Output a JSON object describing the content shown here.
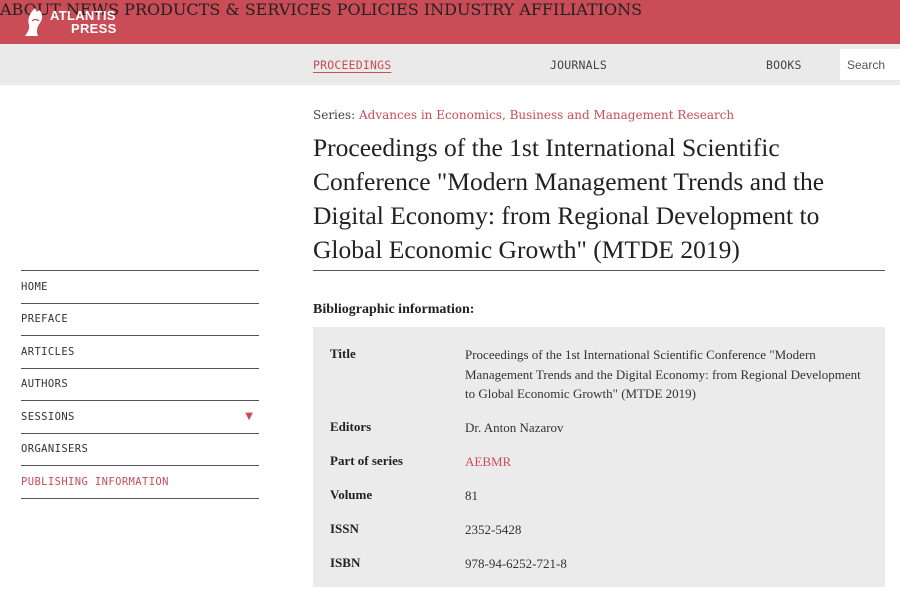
{
  "brand": {
    "line1": "ATLANTIS",
    "line2": "PRESS"
  },
  "topnav": [
    "ABOUT",
    "NEWS",
    "PRODUCTS & SERVICES",
    "POLICIES",
    "INDUSTRY AFFILIATIONS"
  ],
  "subnav": {
    "proceedings": "PROCEEDINGS",
    "journals": "JOURNALS",
    "books": "BOOKS",
    "search_placeholder": "Search"
  },
  "sidebar": [
    {
      "label": "HOME",
      "active": false
    },
    {
      "label": "PREFACE",
      "active": false
    },
    {
      "label": "ARTICLES",
      "active": false
    },
    {
      "label": "AUTHORS",
      "active": false
    },
    {
      "label": "SESSIONS",
      "active": false,
      "expandable": true
    },
    {
      "label": "ORGANISERS",
      "active": false
    },
    {
      "label": "PUBLISHING INFORMATION",
      "active": true
    }
  ],
  "series": {
    "prefix": "Series: ",
    "name": "Advances in Economics, Business and Management Research"
  },
  "title": "Proceedings of the 1st International Scientific Conference \"Modern Management Trends and the Digital Economy: from Regional Development to Global Economic Growth\" (MTDE 2019)",
  "biblio": {
    "heading": "Bibliographic information:",
    "rows": [
      {
        "key": "Title",
        "value": "Proceedings of the 1st International Scientific Conference \"Modern Management Trends and the Digital Economy: from Regional Development to Global Economic Growth\" (MTDE 2019)"
      },
      {
        "key": "Editors",
        "value": "Dr. Anton Nazarov"
      },
      {
        "key": "Part of series",
        "value": "AEBMR",
        "link": true
      },
      {
        "key": "Volume",
        "value": "81"
      },
      {
        "key": "ISSN",
        "value": "2352-5428"
      },
      {
        "key": "ISBN",
        "value": "978-94-6252-721-8"
      }
    ]
  },
  "colors": {
    "brand": "#c94c56",
    "subbar": "#eaeaea",
    "panel": "#ebebeb"
  },
  "icons": {
    "logo": "atlantis-logo-icon",
    "sessions_caret": "caret-down-icon"
  }
}
